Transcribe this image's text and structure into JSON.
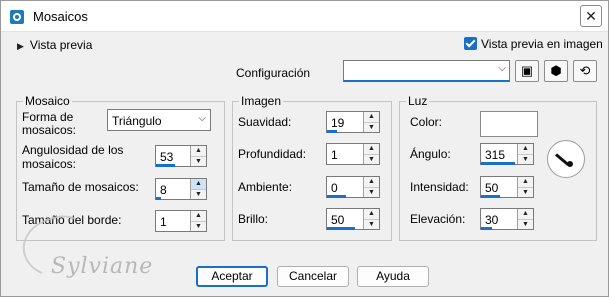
{
  "window": {
    "title": "Mosaicos",
    "close": "✕"
  },
  "preview": {
    "toggle_label": "Vista previa",
    "checkbox_label": "Vista previa en imagen"
  },
  "config": {
    "label": "Configuración",
    "value": ""
  },
  "mosaico": {
    "title": "Mosaico",
    "forma_label_1": "Forma de",
    "forma_label_2": "mosaicos:",
    "forma_value": "Triángulo",
    "angularidad_label_1": "Angulosidad de los",
    "angularidad_label_2": "mosaicos:",
    "angularidad_value": "53",
    "tamano_label": "Tamaño de mosaicos:",
    "tamano_value": "8",
    "borde_label": "Tamaño del borde:",
    "borde_value": "1"
  },
  "imagen": {
    "title": "Imagen",
    "suavidad_label": "Suavidad:",
    "suavidad_value": "19",
    "profundidad_label": "Profundidad:",
    "profundidad_value": "1",
    "ambiente_label": "Ambiente:",
    "ambiente_value": "0",
    "brillo_label": "Brillo:",
    "brillo_value": "50"
  },
  "luz": {
    "title": "Luz",
    "color_label": "Color:",
    "color_value": "#ffffff",
    "angulo_label": "Ángulo:",
    "angulo_value": "315",
    "intensidad_label": "Intensidad:",
    "intensidad_value": "50",
    "elevacion_label": "Elevación:",
    "elevacion_value": "30"
  },
  "buttons": {
    "accept": "Aceptar",
    "cancel": "Cancelar",
    "help": "Ayuda"
  },
  "watermark": "Sylviane",
  "accent_color": "#1a6fc9"
}
